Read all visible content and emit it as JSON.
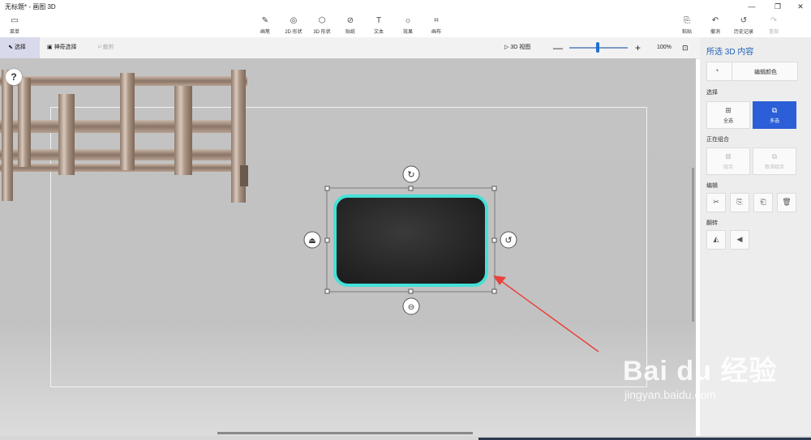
{
  "window": {
    "title": "无标题* - 画图 3D",
    "controls": {
      "minimize": "—",
      "maximize": "❐",
      "close": "✕"
    }
  },
  "ribbon": {
    "menu": {
      "icon": "folder-icon",
      "label": "菜单"
    },
    "tools": [
      {
        "id": "brushes",
        "icon": "brush-icon",
        "label": "画笔"
      },
      {
        "id": "shapes2d",
        "icon": "2d-shapes-icon",
        "label": "2D 形状"
      },
      {
        "id": "shapes3d",
        "icon": "3d-shapes-icon",
        "label": "3D 形状"
      },
      {
        "id": "stickers",
        "icon": "sticker-icon",
        "label": "贴纸"
      },
      {
        "id": "text",
        "icon": "text-icon",
        "label": "文本"
      },
      {
        "id": "effects",
        "icon": "effects-icon",
        "label": "效果"
      },
      {
        "id": "canvas",
        "icon": "canvas-icon",
        "label": "画布"
      }
    ],
    "right": [
      {
        "id": "paste",
        "icon": "paste-icon",
        "label": "粘贴"
      },
      {
        "id": "undo",
        "icon": "undo-icon",
        "label": "撤消"
      },
      {
        "id": "history",
        "icon": "history-icon",
        "label": "历史记录"
      },
      {
        "id": "redo",
        "icon": "redo-icon",
        "label": "重做"
      }
    ]
  },
  "toolbar": {
    "select_label": "选择",
    "magic_select_label": "神奇选择",
    "crop_label": "裁剪",
    "view3d_label": "3D 视图",
    "zoom_minus": "—",
    "zoom_plus": "+",
    "zoom_value": "100%",
    "zoom_level_percent": 100
  },
  "canvas": {
    "help": "?"
  },
  "panel": {
    "title": "所选 3D 内容",
    "edit_color_label": "编辑颜色",
    "select_section": "选择",
    "select_all_label": "全选",
    "multi_select_label": "多选",
    "grouping_section": "正在组合",
    "group_label": "组合",
    "ungroup_label": "取消组合",
    "edit_section": "编辑",
    "edit_icons": [
      "cut-icon",
      "copy-icon",
      "paste-icon",
      "delete-icon"
    ],
    "flip_section": "翻转",
    "flip_icons": [
      "flip-horizontal-icon",
      "flip-vertical-icon"
    ]
  },
  "watermark": {
    "brand": "Bai du 经验",
    "url": "jingyan.baidu.com"
  },
  "colors": {
    "accent": "#2b5ed7",
    "panel_title": "#1f5fb8",
    "selection_glow": "#46e0d8",
    "arrow": "#e8423b"
  }
}
